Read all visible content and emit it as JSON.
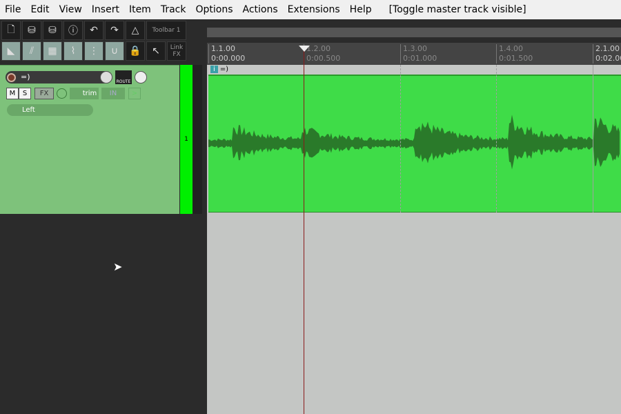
{
  "menu": [
    "File",
    "Edit",
    "View",
    "Insert",
    "Item",
    "Track",
    "Options",
    "Actions",
    "Extensions",
    "Help"
  ],
  "menu_status": "[Toggle master track visible]",
  "toolbar": {
    "label": "Toolbar 1",
    "link_fx": "Link FX",
    "row1_icons": [
      "new-project-icon",
      "open-project-icon",
      "save-project-icon",
      "project-info-icon",
      "undo-icon",
      "redo-icon",
      "metronome-icon"
    ],
    "row2_icons": [
      "auto-crossfade-icon",
      "ripple-edit-icon",
      "grid-snap-icon",
      "envelope-points-icon",
      "grid-lines-icon",
      "loop-icon",
      "lock-icon",
      "pointer-icon"
    ]
  },
  "track": {
    "name": "=)",
    "number": "1",
    "route": "ROUTE",
    "mute": "M",
    "solo": "S",
    "fx": "FX",
    "trim": "trim",
    "input": "IN",
    "pan_channel": "Left"
  },
  "ruler": [
    {
      "bar": "1.1.00",
      "time": "0:00.000"
    },
    {
      "bar": "1.2.00",
      "time": "0:00.500"
    },
    {
      "bar": "1.3.00",
      "time": "0:01.000"
    },
    {
      "bar": "1.4.00",
      "time": "0:01.500"
    },
    {
      "bar": "2.1.00",
      "time": "0:02.00"
    }
  ],
  "item": {
    "name": "=)",
    "badge": "i"
  },
  "colors": {
    "track": "#7ec27b",
    "item": "#3fdc48",
    "meter": "#00f000",
    "playhead": "#8a1a1a"
  }
}
